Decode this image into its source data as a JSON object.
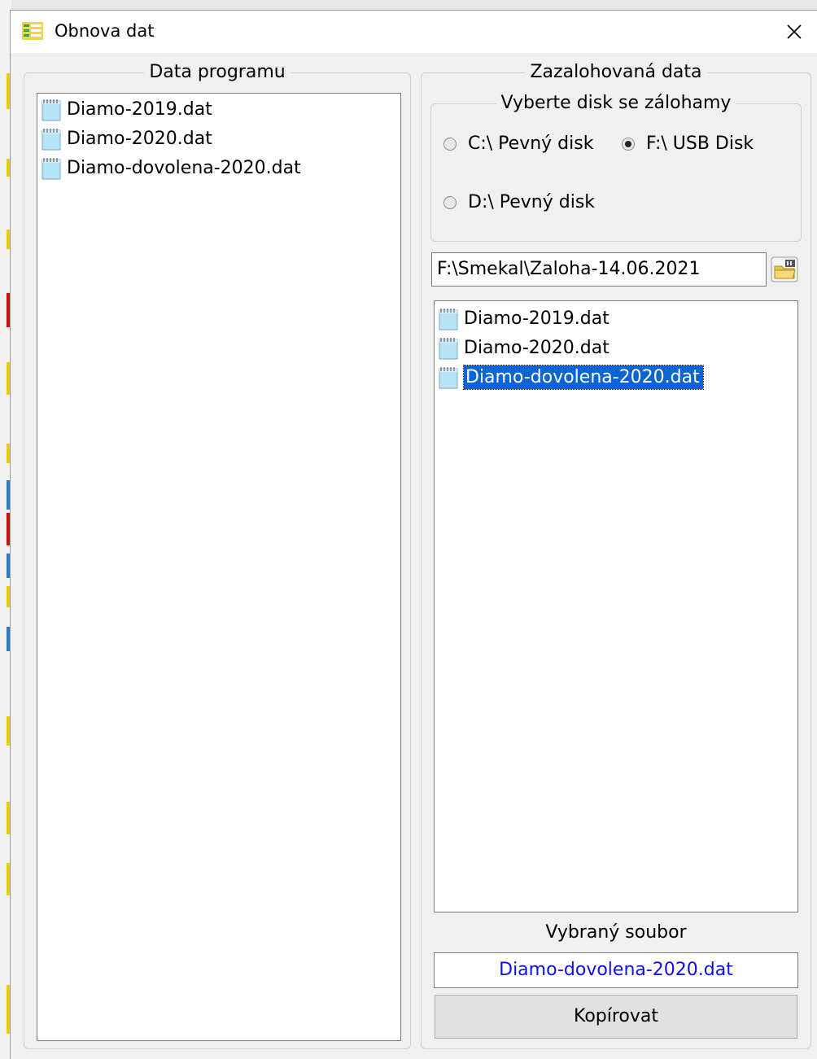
{
  "window": {
    "title": "Obnova dat"
  },
  "left_group": {
    "legend": "Data programu",
    "files": [
      "Diamo-2019.dat",
      "Diamo-2020.dat",
      "Diamo-dovolena-2020.dat"
    ]
  },
  "right_group": {
    "legend": "Zazalohovaná data",
    "disk_group": {
      "legend": "Vyberte disk se zálohamy",
      "options": [
        {
          "label": "C:\\ Pevný disk",
          "checked": false
        },
        {
          "label": "F:\\ USB Disk",
          "checked": true
        },
        {
          "label": "D:\\ Pevný disk",
          "checked": false
        }
      ]
    },
    "path_value": "F:\\Smekal\\Zaloha-14.06.2021",
    "files": [
      "Diamo-2019.dat",
      "Diamo-2020.dat",
      "Diamo-dovolena-2020.dat"
    ],
    "selected_index": 2,
    "selected_label": "Vybraný soubor",
    "selected_value": "Diamo-dovolena-2020.dat",
    "copy_button": "Kopírovat"
  },
  "colors": {
    "selection": "#0a64d4",
    "selected_text": "#1010e0"
  },
  "icons": {
    "app": "list-app-icon",
    "file": "notepad-file-icon",
    "browse": "open-folder-icon",
    "close": "close-icon"
  }
}
